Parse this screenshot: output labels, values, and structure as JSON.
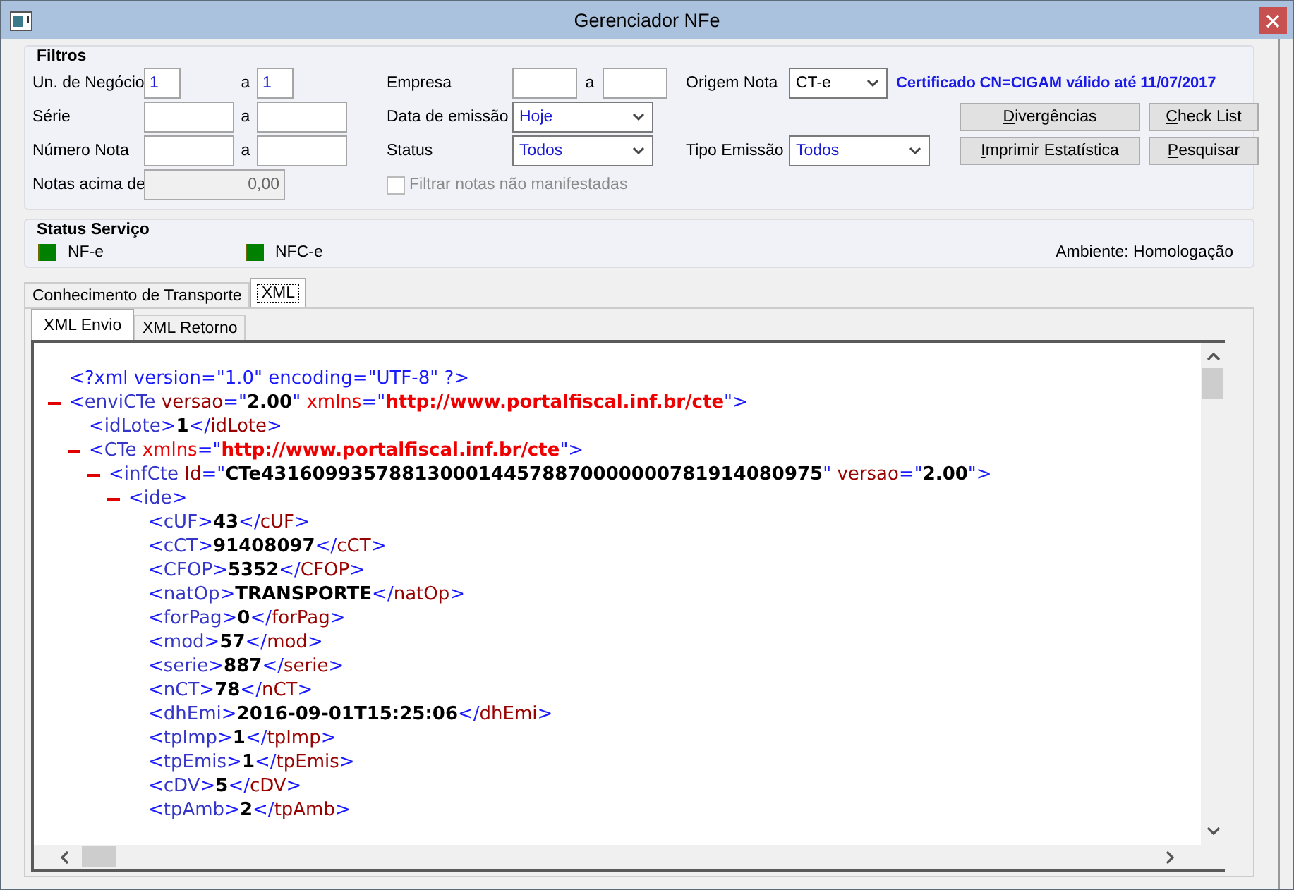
{
  "window": {
    "title": "Gerenciador NFe"
  },
  "filters": {
    "title": "Filtros",
    "un_negocio": {
      "label": "Un. de Negócio",
      "from": "1",
      "separator": "a",
      "to": "1"
    },
    "serie": {
      "label": "Série",
      "separator": "a"
    },
    "numero_nota": {
      "label": "Número Nota",
      "separator": "a"
    },
    "notas_acima_de": {
      "label": "Notas acima de",
      "value": "0,00",
      "disabled": true
    },
    "empresa": {
      "label": "Empresa",
      "separator": "a"
    },
    "data_emissao": {
      "label": "Data de emissão",
      "value": "Hoje"
    },
    "status": {
      "label": "Status",
      "value": "Todos"
    },
    "filtrar": {
      "label": "Filtrar notas não manifestadas",
      "checked": false,
      "disabled": true
    },
    "origem_nota": {
      "label": "Origem Nota",
      "value": "CT-e"
    },
    "tipo_emissao": {
      "label": "Tipo Emissão",
      "value": "Todos"
    },
    "certificate": "Certificado CN=CIGAM válido até 11/07/2017",
    "buttons": [
      {
        "label": "Divergências"
      },
      {
        "label": "Check List"
      },
      {
        "label": "Imprimir Estatística"
      },
      {
        "label": "Pesquisar"
      }
    ]
  },
  "status_service": {
    "title": "Status Serviço",
    "services": [
      {
        "label": "NF-e",
        "color": "#008000"
      },
      {
        "label": "NFC-e",
        "color": "#008000"
      }
    ],
    "ambiente": "Ambiente: Homologação"
  },
  "tabs": [
    {
      "label": "Conhecimento de Transporte",
      "selected": false
    },
    {
      "label": "XML",
      "selected": true
    }
  ],
  "subtabs": [
    {
      "label": "XML Envio",
      "selected": true
    },
    {
      "label": "XML Retorno",
      "selected": false
    }
  ],
  "xml": {
    "declaration": "<?xml version=\"1.0\" encoding=\"UTF-8\" ?>",
    "root": {
      "expanded": true,
      "line": [
        {
          "kind": "markup",
          "text": "<"
        },
        {
          "kind": "tag",
          "text": "enviCTe"
        },
        {
          "kind": "attribute",
          "text": " versao"
        },
        {
          "kind": "markup",
          "text": "=\""
        },
        {
          "kind": "value",
          "text": "2.00"
        },
        {
          "kind": "markup",
          "text": "\""
        },
        {
          "kind": "namespace",
          "text": " xmlns"
        },
        {
          "kind": "markup",
          "text": "=\""
        },
        {
          "kind": "namespace_value",
          "text": "http://www.portalfiscal.inf.br/cte"
        },
        {
          "kind": "markup",
          "text": "\">"
        }
      ],
      "children": [
        {
          "line": [
            {
              "kind": "markup",
              "text": "<"
            },
            {
              "kind": "tag",
              "text": "idLote"
            },
            {
              "kind": "markup",
              "text": ">"
            },
            {
              "kind": "text",
              "text": "1"
            },
            {
              "kind": "markup",
              "text": "</"
            },
            {
              "kind": "close_tag",
              "text": "idLote"
            },
            {
              "kind": "markup",
              "text": ">"
            }
          ]
        },
        {
          "expanded": true,
          "line": [
            {
              "kind": "markup",
              "text": "<"
            },
            {
              "kind": "tag",
              "text": "CTe"
            },
            {
              "kind": "namespace",
              "text": " xmlns"
            },
            {
              "kind": "markup",
              "text": "=\""
            },
            {
              "kind": "namespace_value",
              "text": "http://www.portalfiscal.inf.br/cte"
            },
            {
              "kind": "markup",
              "text": "\">"
            }
          ],
          "children": [
            {
              "expanded": true,
              "line": [
                {
                  "kind": "markup",
                  "text": "<"
                },
                {
                  "kind": "tag",
                  "text": "infCte"
                },
                {
                  "kind": "attribute",
                  "text": " Id"
                },
                {
                  "kind": "markup",
                  "text": "=\""
                },
                {
                  "kind": "value",
                  "text": "CTe43160993578813000144578870000000781914080975"
                },
                {
                  "kind": "markup",
                  "text": "\""
                },
                {
                  "kind": "attribute",
                  "text": " versao"
                },
                {
                  "kind": "markup",
                  "text": "=\""
                },
                {
                  "kind": "value",
                  "text": "2.00"
                },
                {
                  "kind": "markup",
                  "text": "\">"
                }
              ],
              "children": [
                {
                  "expanded": true,
                  "line": [
                    {
                      "kind": "markup",
                      "text": "<"
                    },
                    {
                      "kind": "tag",
                      "text": "ide"
                    },
                    {
                      "kind": "markup",
                      "text": ">"
                    }
                  ],
                  "children": [
                    {
                      "line": [
                        {
                          "kind": "markup",
                          "text": "<"
                        },
                        {
                          "kind": "tag",
                          "text": "cUF"
                        },
                        {
                          "kind": "markup",
                          "text": ">"
                        },
                        {
                          "kind": "text",
                          "text": "43"
                        },
                        {
                          "kind": "markup",
                          "text": "</"
                        },
                        {
                          "kind": "close_tag",
                          "text": "cUF"
                        },
                        {
                          "kind": "markup",
                          "text": ">"
                        }
                      ]
                    },
                    {
                      "line": [
                        {
                          "kind": "markup",
                          "text": "<"
                        },
                        {
                          "kind": "tag",
                          "text": "cCT"
                        },
                        {
                          "kind": "markup",
                          "text": ">"
                        },
                        {
                          "kind": "text",
                          "text": "91408097"
                        },
                        {
                          "kind": "markup",
                          "text": "</"
                        },
                        {
                          "kind": "close_tag",
                          "text": "cCT"
                        },
                        {
                          "kind": "markup",
                          "text": ">"
                        }
                      ]
                    },
                    {
                      "line": [
                        {
                          "kind": "markup",
                          "text": "<"
                        },
                        {
                          "kind": "tag",
                          "text": "CFOP"
                        },
                        {
                          "kind": "markup",
                          "text": ">"
                        },
                        {
                          "kind": "text",
                          "text": "5352"
                        },
                        {
                          "kind": "markup",
                          "text": "</"
                        },
                        {
                          "kind": "close_tag",
                          "text": "CFOP"
                        },
                        {
                          "kind": "markup",
                          "text": ">"
                        }
                      ]
                    },
                    {
                      "line": [
                        {
                          "kind": "markup",
                          "text": "<"
                        },
                        {
                          "kind": "tag",
                          "text": "natOp"
                        },
                        {
                          "kind": "markup",
                          "text": ">"
                        },
                        {
                          "kind": "text",
                          "text": "TRANSPORTE"
                        },
                        {
                          "kind": "markup",
                          "text": "</"
                        },
                        {
                          "kind": "close_tag",
                          "text": "natOp"
                        },
                        {
                          "kind": "markup",
                          "text": ">"
                        }
                      ]
                    },
                    {
                      "line": [
                        {
                          "kind": "markup",
                          "text": "<"
                        },
                        {
                          "kind": "tag",
                          "text": "forPag"
                        },
                        {
                          "kind": "markup",
                          "text": ">"
                        },
                        {
                          "kind": "text",
                          "text": "0"
                        },
                        {
                          "kind": "markup",
                          "text": "</"
                        },
                        {
                          "kind": "close_tag",
                          "text": "forPag"
                        },
                        {
                          "kind": "markup",
                          "text": ">"
                        }
                      ]
                    },
                    {
                      "line": [
                        {
                          "kind": "markup",
                          "text": "<"
                        },
                        {
                          "kind": "tag",
                          "text": "mod"
                        },
                        {
                          "kind": "markup",
                          "text": ">"
                        },
                        {
                          "kind": "text",
                          "text": "57"
                        },
                        {
                          "kind": "markup",
                          "text": "</"
                        },
                        {
                          "kind": "close_tag",
                          "text": "mod"
                        },
                        {
                          "kind": "markup",
                          "text": ">"
                        }
                      ]
                    },
                    {
                      "line": [
                        {
                          "kind": "markup",
                          "text": "<"
                        },
                        {
                          "kind": "tag",
                          "text": "serie"
                        },
                        {
                          "kind": "markup",
                          "text": ">"
                        },
                        {
                          "kind": "text",
                          "text": "887"
                        },
                        {
                          "kind": "markup",
                          "text": "</"
                        },
                        {
                          "kind": "close_tag",
                          "text": "serie"
                        },
                        {
                          "kind": "markup",
                          "text": ">"
                        }
                      ]
                    },
                    {
                      "line": [
                        {
                          "kind": "markup",
                          "text": "<"
                        },
                        {
                          "kind": "tag",
                          "text": "nCT"
                        },
                        {
                          "kind": "markup",
                          "text": ">"
                        },
                        {
                          "kind": "text",
                          "text": "78"
                        },
                        {
                          "kind": "markup",
                          "text": "</"
                        },
                        {
                          "kind": "close_tag",
                          "text": "nCT"
                        },
                        {
                          "kind": "markup",
                          "text": ">"
                        }
                      ]
                    },
                    {
                      "line": [
                        {
                          "kind": "markup",
                          "text": "<"
                        },
                        {
                          "kind": "tag",
                          "text": "dhEmi"
                        },
                        {
                          "kind": "markup",
                          "text": ">"
                        },
                        {
                          "kind": "text",
                          "text": "2016-09-01T15:25:06"
                        },
                        {
                          "kind": "markup",
                          "text": "</"
                        },
                        {
                          "kind": "close_tag",
                          "text": "dhEmi"
                        },
                        {
                          "kind": "markup",
                          "text": ">"
                        }
                      ]
                    },
                    {
                      "line": [
                        {
                          "kind": "markup",
                          "text": "<"
                        },
                        {
                          "kind": "tag",
                          "text": "tpImp"
                        },
                        {
                          "kind": "markup",
                          "text": ">"
                        },
                        {
                          "kind": "text",
                          "text": "1"
                        },
                        {
                          "kind": "markup",
                          "text": "</"
                        },
                        {
                          "kind": "close_tag",
                          "text": "tpImp"
                        },
                        {
                          "kind": "markup",
                          "text": ">"
                        }
                      ]
                    },
                    {
                      "line": [
                        {
                          "kind": "markup",
                          "text": "<"
                        },
                        {
                          "kind": "tag",
                          "text": "tpEmis"
                        },
                        {
                          "kind": "markup",
                          "text": ">"
                        },
                        {
                          "kind": "text",
                          "text": "1"
                        },
                        {
                          "kind": "markup",
                          "text": "</"
                        },
                        {
                          "kind": "close_tag",
                          "text": "tpEmis"
                        },
                        {
                          "kind": "markup",
                          "text": ">"
                        }
                      ]
                    },
                    {
                      "line": [
                        {
                          "kind": "markup",
                          "text": "<"
                        },
                        {
                          "kind": "tag",
                          "text": "cDV"
                        },
                        {
                          "kind": "markup",
                          "text": ">"
                        },
                        {
                          "kind": "text",
                          "text": "5"
                        },
                        {
                          "kind": "markup",
                          "text": "</"
                        },
                        {
                          "kind": "close_tag",
                          "text": "cDV"
                        },
                        {
                          "kind": "markup",
                          "text": ">"
                        }
                      ]
                    },
                    {
                      "line": [
                        {
                          "kind": "markup",
                          "text": "<"
                        },
                        {
                          "kind": "tag",
                          "text": "tpAmb"
                        },
                        {
                          "kind": "markup",
                          "text": ">"
                        },
                        {
                          "kind": "text",
                          "text": "2"
                        },
                        {
                          "kind": "markup",
                          "text": "</"
                        },
                        {
                          "kind": "close_tag",
                          "text": "tpAmb"
                        },
                        {
                          "kind": "markup",
                          "text": ">"
                        }
                      ]
                    }
                  ]
                }
              ]
            }
          ]
        }
      ]
    }
  }
}
